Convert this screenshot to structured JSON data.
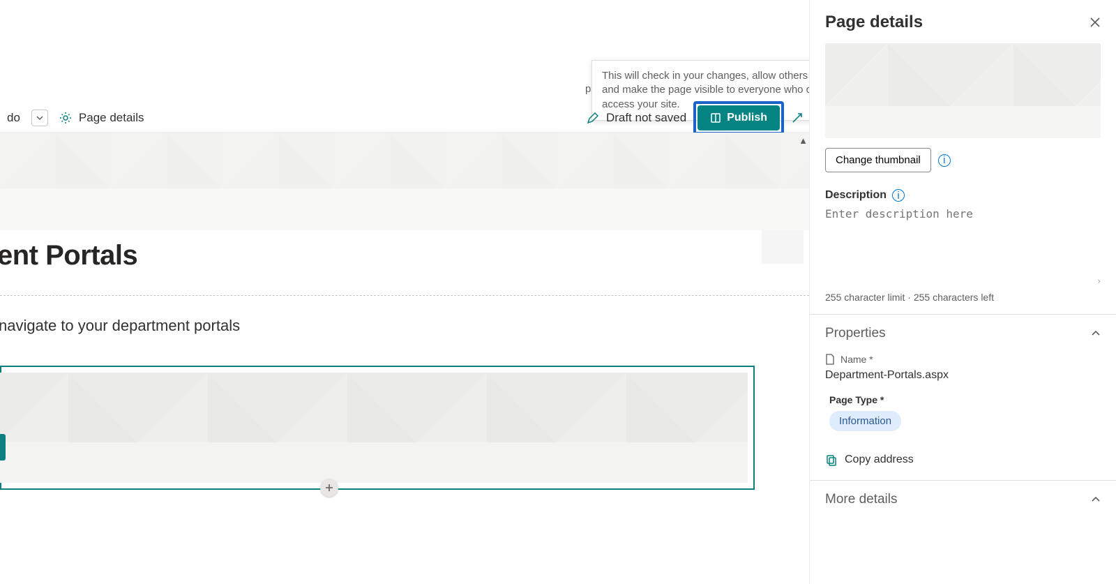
{
  "toolbar": {
    "do_label": "do",
    "page_details_label": "Page details",
    "draft_status": "Draft not saved",
    "publish_label": "Publish"
  },
  "tooltip": {
    "text": "This will check in your changes, allow others to edit, and make the page visible to everyone who can access your site."
  },
  "page": {
    "title_suffix": "ent Portals",
    "subtitle_suffix": "navigate to your department portals"
  },
  "panel": {
    "title": "Page details",
    "change_thumbnail_label": "Change thumbnail",
    "description_label": "Description",
    "description_placeholder": "Enter description here",
    "char_limit_text": "255 character limit · 255 characters left",
    "properties_title": "Properties",
    "name_label": "Name *",
    "name_value": "Department-Portals.aspx",
    "page_type_label": "Page Type *",
    "page_type_value": "Information",
    "copy_address_label": "Copy address",
    "more_details_label": "More details"
  }
}
